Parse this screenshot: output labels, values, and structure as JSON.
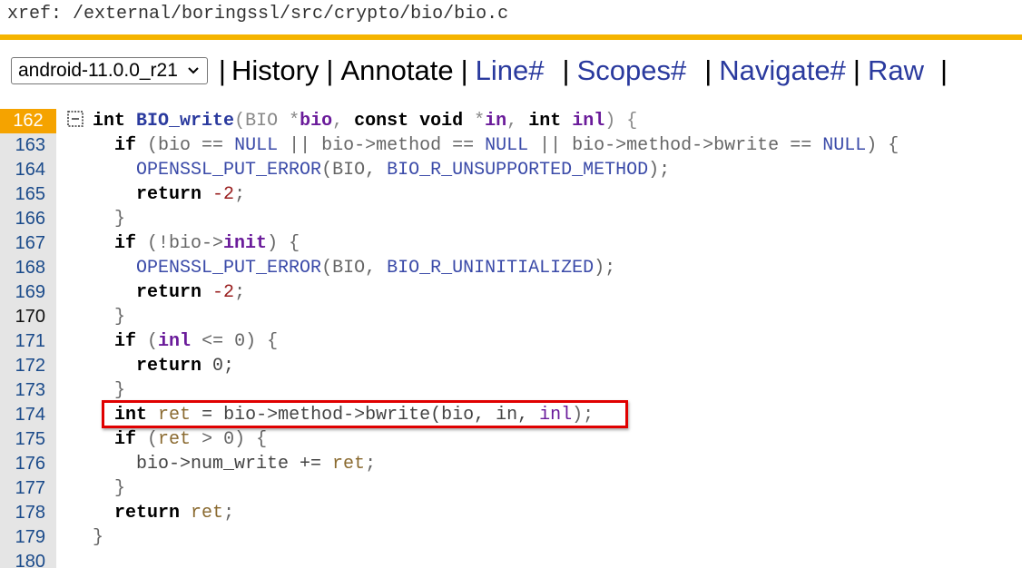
{
  "breadcrumb": "xref: /external/boringssl/src/crypto/bio/bio.c",
  "nav": {
    "version": "android-11.0.0_r21",
    "separator": "|",
    "items": [
      "History",
      "Annotate",
      "Line#",
      "Scopes#",
      "Navigate#",
      "Raw"
    ]
  },
  "code": {
    "highlighted_line": "162",
    "lines": [
      {
        "n": "162"
      },
      {
        "n": "163"
      },
      {
        "n": "164"
      },
      {
        "n": "165"
      },
      {
        "n": "166"
      },
      {
        "n": "167"
      },
      {
        "n": "168"
      },
      {
        "n": "169"
      },
      {
        "n": "170"
      },
      {
        "n": "171"
      },
      {
        "n": "172"
      },
      {
        "n": "173"
      },
      {
        "n": "174"
      },
      {
        "n": "175"
      },
      {
        "n": "176"
      },
      {
        "n": "177"
      },
      {
        "n": "178"
      },
      {
        "n": "179"
      },
      {
        "n": "180"
      }
    ],
    "text": {
      "l162": [
        "int",
        " ",
        "BIO_write",
        "(BIO *",
        "bio",
        ", ",
        "const",
        " ",
        "void",
        " *",
        "in",
        ", ",
        "int",
        " ",
        "inl",
        ") {"
      ],
      "l163": [
        "  ",
        "if",
        " (bio == ",
        "NULL",
        " || bio->method == ",
        "NULL",
        " || bio->method->bwrite == ",
        "NULL",
        ") {"
      ],
      "l164": [
        "    ",
        "OPENSSL_PUT_ERROR",
        "(BIO, ",
        "BIO_R_UNSUPPORTED_METHOD",
        ");"
      ],
      "l165": [
        "    ",
        "return",
        " ",
        "-2",
        ";"
      ],
      "l166": [
        "  }"
      ],
      "l167": [
        "  ",
        "if",
        " (!bio->",
        "init",
        ") {"
      ],
      "l168": [
        "    ",
        "OPENSSL_PUT_ERROR",
        "(BIO, ",
        "BIO_R_UNINITIALIZED",
        ");"
      ],
      "l169": [
        "    ",
        "return",
        " ",
        "-2",
        ";"
      ],
      "l170": [
        "  }"
      ],
      "l171": [
        "  ",
        "if",
        " (",
        "inl",
        " <= 0) {"
      ],
      "l172": [
        "    ",
        "return",
        " 0;"
      ],
      "l173": [
        "  }"
      ],
      "l174": [
        "  ",
        "int",
        " ",
        "ret",
        " = bio->method->bwrite(bio, in, ",
        "inl",
        ");"
      ],
      "l175": [
        "  ",
        "if",
        " (",
        "ret",
        " > 0) {"
      ],
      "l176": [
        "    bio->num_write += ",
        "ret",
        ";"
      ],
      "l177": [
        "  }"
      ],
      "l178": [
        "  ",
        "return",
        " ",
        "ret",
        ";"
      ],
      "l179": [
        "}"
      ],
      "l180": [
        ""
      ]
    }
  },
  "icons": {
    "version_dropdown": "chevron-down-icon",
    "fold": "collapse-box-icon"
  },
  "colors": {
    "accent_bar": "#f5b400",
    "link": "#2a3a9e",
    "highlight_box": "#e00000",
    "current_line": "#f5a300"
  }
}
